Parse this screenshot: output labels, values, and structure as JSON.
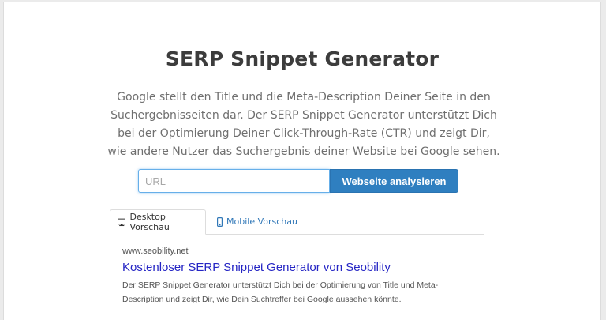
{
  "header": {
    "title": "SERP Snippet Generator",
    "intro": "Google stellt den Title und die Meta-Description Deiner Seite in den Suchergebnisseiten dar. Der SERP Snippet Generator unterstützt Dich bei der Optimierung Deiner Click-Through-Rate (CTR) und zeigt Dir, wie andere Nutzer das Suchergebnis deiner Website bei Google sehen."
  },
  "search": {
    "placeholder": "URL",
    "value": "",
    "button_label": "Webseite analysieren"
  },
  "tabs": [
    {
      "label": "Desktop Vorschau",
      "icon": "monitor-icon",
      "active": true
    },
    {
      "label": "Mobile Vorschau",
      "icon": "smartphone-icon",
      "active": false
    }
  ],
  "preview": {
    "url": "www.seobility.net",
    "title": "Kostenloser SERP Snippet Generator von Seobility",
    "description": "Der SERP Snippet Generator unterstützt Dich bei der Optimierung von Title und Meta-Description und zeigt Dir, wie Dein Suchtreffer bei Google aussehen könnte."
  },
  "colors": {
    "accent": "#2f7fc0",
    "link_blue": "#2525c4",
    "tab_link": "#3178b8"
  }
}
